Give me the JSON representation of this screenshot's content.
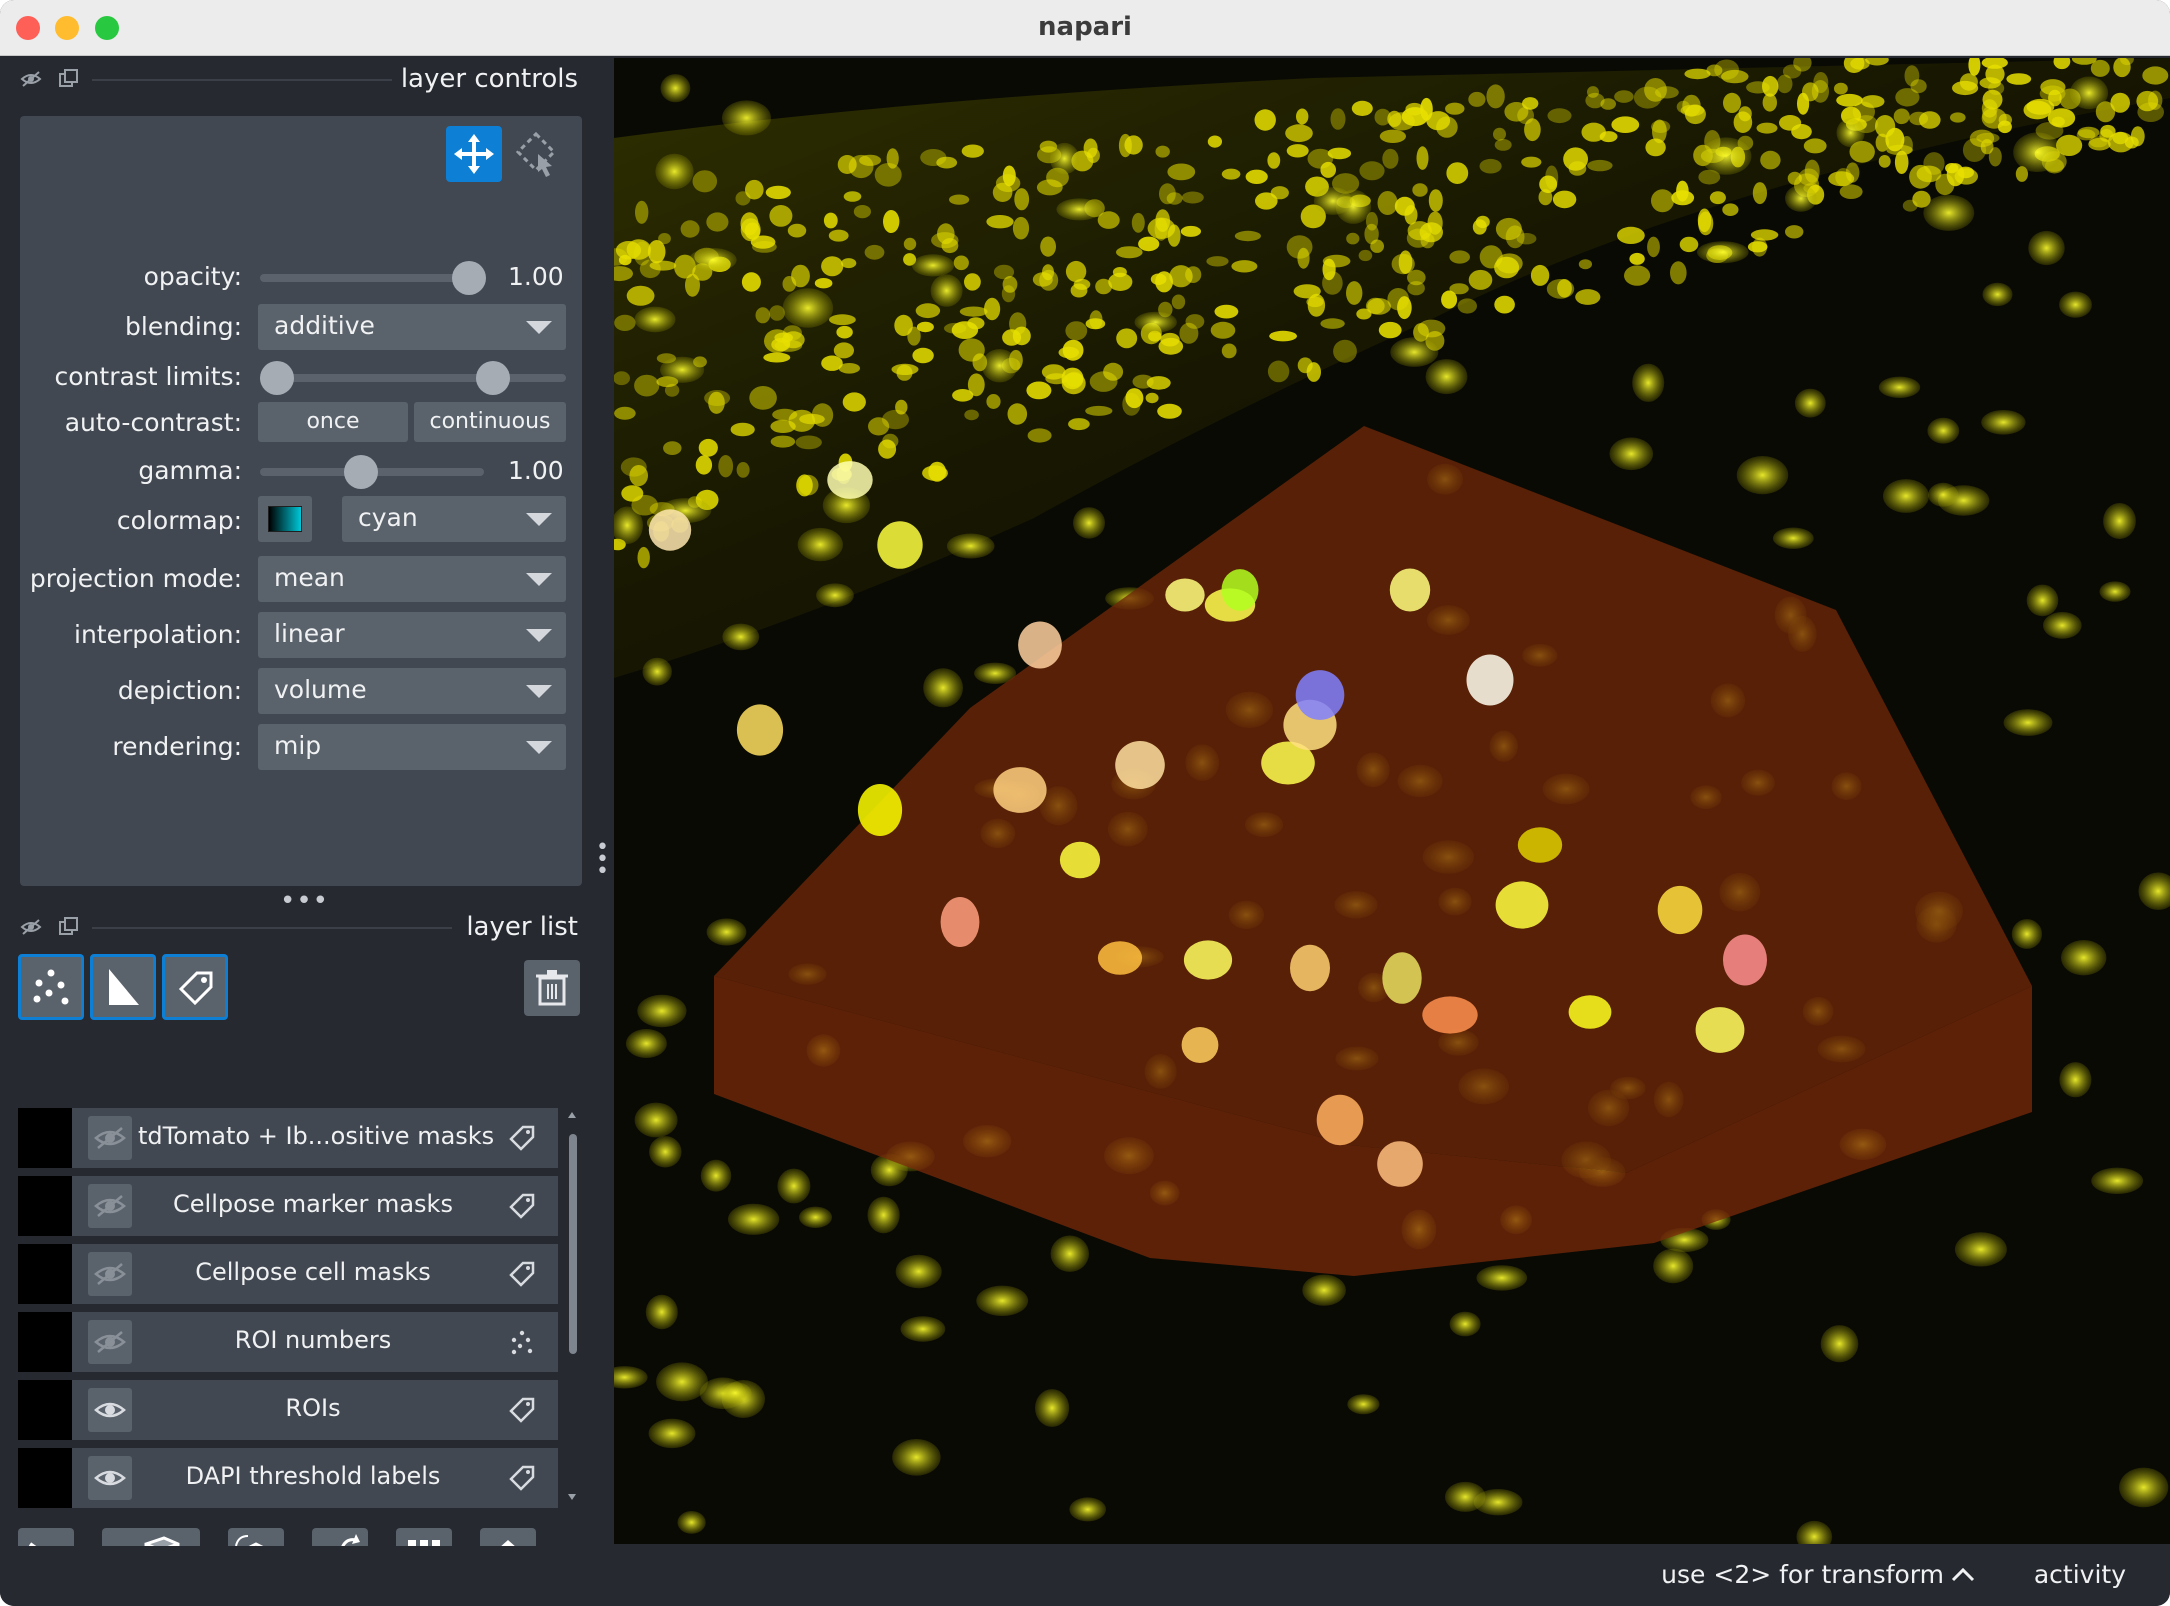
{
  "window": {
    "title": "napari"
  },
  "layer_controls": {
    "title": "layer controls",
    "opacity": {
      "label": "opacity:",
      "value": "1.00",
      "level": 1.0
    },
    "blending": {
      "label": "blending:",
      "value": "additive"
    },
    "contrast_limits": {
      "label": "contrast limits:",
      "low": 0.0,
      "high": 0.78
    },
    "auto_contrast": {
      "label": "auto-contrast:",
      "once": "once",
      "continuous": "continuous"
    },
    "gamma": {
      "label": "gamma:",
      "value": "1.00",
      "level": 0.45
    },
    "colormap": {
      "label": "colormap:",
      "value": "cyan",
      "swatch_color": "#00c8d8"
    },
    "projection_mode": {
      "label": "projection mode:",
      "value": "mean"
    },
    "interpolation": {
      "label": "interpolation:",
      "value": "linear"
    },
    "depiction": {
      "label": "depiction:",
      "value": "volume"
    },
    "rendering": {
      "label": "rendering:",
      "value": "mip"
    }
  },
  "layer_list": {
    "title": "layer list",
    "layers": [
      {
        "name": "tdTomato + Ib...ositive masks",
        "type_icon": "label-icon",
        "visible": false
      },
      {
        "name": "Cellpose marker masks",
        "type_icon": "label-icon",
        "visible": false
      },
      {
        "name": "Cellpose cell masks",
        "type_icon": "label-icon",
        "visible": false
      },
      {
        "name": "ROI numbers",
        "type_icon": "points-icon",
        "visible": false
      },
      {
        "name": "ROIs",
        "type_icon": "label-icon",
        "visible": true
      },
      {
        "name": "DAPI threshold labels",
        "type_icon": "label-icon",
        "visible": true
      }
    ]
  },
  "status": {
    "message": "use <2> for transform",
    "activity": "activity"
  },
  "colors": {
    "accent": "#0d7fd4",
    "panel": "#414851",
    "background": "#262930",
    "nuclei": "#e8e000",
    "roi": "#8a2e0a"
  }
}
